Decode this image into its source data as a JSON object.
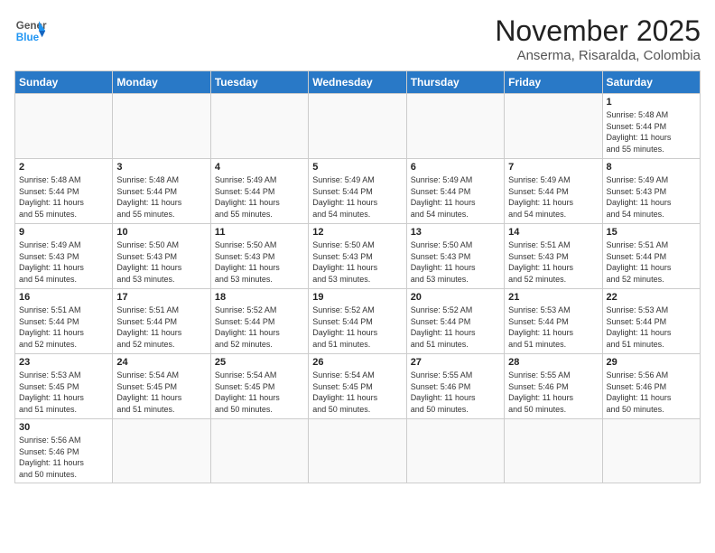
{
  "header": {
    "logo_general": "General",
    "logo_blue": "Blue",
    "month_year": "November 2025",
    "location": "Anserma, Risaralda, Colombia"
  },
  "weekdays": [
    "Sunday",
    "Monday",
    "Tuesday",
    "Wednesday",
    "Thursday",
    "Friday",
    "Saturday"
  ],
  "weeks": [
    [
      {
        "day": "",
        "info": ""
      },
      {
        "day": "",
        "info": ""
      },
      {
        "day": "",
        "info": ""
      },
      {
        "day": "",
        "info": ""
      },
      {
        "day": "",
        "info": ""
      },
      {
        "day": "",
        "info": ""
      },
      {
        "day": "1",
        "info": "Sunrise: 5:48 AM\nSunset: 5:44 PM\nDaylight: 11 hours\nand 55 minutes."
      }
    ],
    [
      {
        "day": "2",
        "info": "Sunrise: 5:48 AM\nSunset: 5:44 PM\nDaylight: 11 hours\nand 55 minutes."
      },
      {
        "day": "3",
        "info": "Sunrise: 5:48 AM\nSunset: 5:44 PM\nDaylight: 11 hours\nand 55 minutes."
      },
      {
        "day": "4",
        "info": "Sunrise: 5:49 AM\nSunset: 5:44 PM\nDaylight: 11 hours\nand 55 minutes."
      },
      {
        "day": "5",
        "info": "Sunrise: 5:49 AM\nSunset: 5:44 PM\nDaylight: 11 hours\nand 54 minutes."
      },
      {
        "day": "6",
        "info": "Sunrise: 5:49 AM\nSunset: 5:44 PM\nDaylight: 11 hours\nand 54 minutes."
      },
      {
        "day": "7",
        "info": "Sunrise: 5:49 AM\nSunset: 5:44 PM\nDaylight: 11 hours\nand 54 minutes."
      },
      {
        "day": "8",
        "info": "Sunrise: 5:49 AM\nSunset: 5:43 PM\nDaylight: 11 hours\nand 54 minutes."
      }
    ],
    [
      {
        "day": "9",
        "info": "Sunrise: 5:49 AM\nSunset: 5:43 PM\nDaylight: 11 hours\nand 54 minutes."
      },
      {
        "day": "10",
        "info": "Sunrise: 5:50 AM\nSunset: 5:43 PM\nDaylight: 11 hours\nand 53 minutes."
      },
      {
        "day": "11",
        "info": "Sunrise: 5:50 AM\nSunset: 5:43 PM\nDaylight: 11 hours\nand 53 minutes."
      },
      {
        "day": "12",
        "info": "Sunrise: 5:50 AM\nSunset: 5:43 PM\nDaylight: 11 hours\nand 53 minutes."
      },
      {
        "day": "13",
        "info": "Sunrise: 5:50 AM\nSunset: 5:43 PM\nDaylight: 11 hours\nand 53 minutes."
      },
      {
        "day": "14",
        "info": "Sunrise: 5:51 AM\nSunset: 5:43 PM\nDaylight: 11 hours\nand 52 minutes."
      },
      {
        "day": "15",
        "info": "Sunrise: 5:51 AM\nSunset: 5:44 PM\nDaylight: 11 hours\nand 52 minutes."
      }
    ],
    [
      {
        "day": "16",
        "info": "Sunrise: 5:51 AM\nSunset: 5:44 PM\nDaylight: 11 hours\nand 52 minutes."
      },
      {
        "day": "17",
        "info": "Sunrise: 5:51 AM\nSunset: 5:44 PM\nDaylight: 11 hours\nand 52 minutes."
      },
      {
        "day": "18",
        "info": "Sunrise: 5:52 AM\nSunset: 5:44 PM\nDaylight: 11 hours\nand 52 minutes."
      },
      {
        "day": "19",
        "info": "Sunrise: 5:52 AM\nSunset: 5:44 PM\nDaylight: 11 hours\nand 51 minutes."
      },
      {
        "day": "20",
        "info": "Sunrise: 5:52 AM\nSunset: 5:44 PM\nDaylight: 11 hours\nand 51 minutes."
      },
      {
        "day": "21",
        "info": "Sunrise: 5:53 AM\nSunset: 5:44 PM\nDaylight: 11 hours\nand 51 minutes."
      },
      {
        "day": "22",
        "info": "Sunrise: 5:53 AM\nSunset: 5:44 PM\nDaylight: 11 hours\nand 51 minutes."
      }
    ],
    [
      {
        "day": "23",
        "info": "Sunrise: 5:53 AM\nSunset: 5:45 PM\nDaylight: 11 hours\nand 51 minutes."
      },
      {
        "day": "24",
        "info": "Sunrise: 5:54 AM\nSunset: 5:45 PM\nDaylight: 11 hours\nand 51 minutes."
      },
      {
        "day": "25",
        "info": "Sunrise: 5:54 AM\nSunset: 5:45 PM\nDaylight: 11 hours\nand 50 minutes."
      },
      {
        "day": "26",
        "info": "Sunrise: 5:54 AM\nSunset: 5:45 PM\nDaylight: 11 hours\nand 50 minutes."
      },
      {
        "day": "27",
        "info": "Sunrise: 5:55 AM\nSunset: 5:46 PM\nDaylight: 11 hours\nand 50 minutes."
      },
      {
        "day": "28",
        "info": "Sunrise: 5:55 AM\nSunset: 5:46 PM\nDaylight: 11 hours\nand 50 minutes."
      },
      {
        "day": "29",
        "info": "Sunrise: 5:56 AM\nSunset: 5:46 PM\nDaylight: 11 hours\nand 50 minutes."
      }
    ],
    [
      {
        "day": "30",
        "info": "Sunrise: 5:56 AM\nSunset: 5:46 PM\nDaylight: 11 hours\nand 50 minutes."
      },
      {
        "day": "",
        "info": ""
      },
      {
        "day": "",
        "info": ""
      },
      {
        "day": "",
        "info": ""
      },
      {
        "day": "",
        "info": ""
      },
      {
        "day": "",
        "info": ""
      },
      {
        "day": "",
        "info": ""
      }
    ]
  ]
}
